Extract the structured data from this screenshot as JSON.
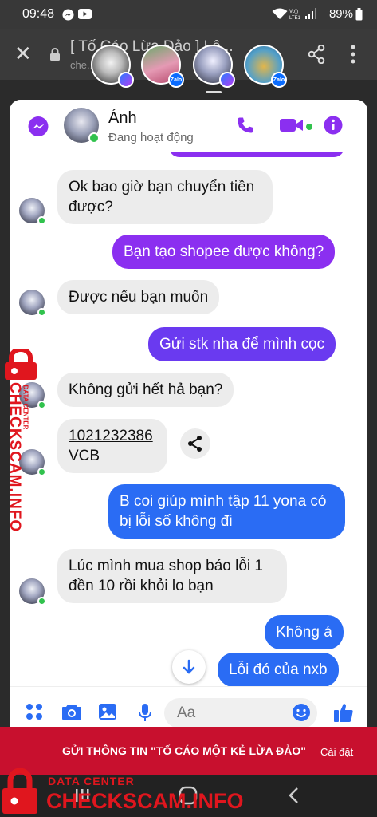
{
  "status_bar": {
    "time": "09:48",
    "battery": "89%"
  },
  "browser": {
    "title": "[ Tố Cáo Lừa Đảo ] Lê...",
    "url": "che...in"
  },
  "chat_heads": [
    {
      "badge": "messenger"
    },
    {
      "badge": "zalo",
      "badge_label": "Zalo"
    },
    {
      "badge": "messenger"
    },
    {
      "badge": "zalo",
      "badge_label": "Zalo"
    }
  ],
  "header": {
    "name": "Ánh",
    "status": "Đang hoạt động"
  },
  "messages": [
    {
      "from": "them",
      "text": "Ok bao giờ bạn chuyển tiền được?"
    },
    {
      "from": "me",
      "text": "Bạn tạo shopee được không?"
    },
    {
      "from": "them",
      "text": "Được nếu bạn muốn"
    },
    {
      "from": "me",
      "text": "Gửi stk nha để mình cọc"
    },
    {
      "from": "them",
      "text": "Không gửi hết hả bạn?"
    },
    {
      "from": "them",
      "account": "1021232386",
      "bank": "VCB"
    },
    {
      "from": "me",
      "text": "B coi giúp mình tập 11 yona có bị lỗi số không đi"
    },
    {
      "from": "them",
      "text": "Lúc mình mua shop báo lỗi 1 đền 10 rồi khỏi lo bạn"
    },
    {
      "from": "me",
      "text": "Không á"
    },
    {
      "from": "me",
      "text": "Lỗi đó của nxb"
    }
  ],
  "composer": {
    "placeholder": "Aa"
  },
  "banner": {
    "text": "GỬI THÔNG TIN \"TỐ CÁO MỘT KẺ LỪA ĐẢO\"",
    "settings": "Cài đặt"
  },
  "watermark": {
    "top_line": "DATA CENTER",
    "brand": "CHECKSCAM.INFO"
  },
  "colors": {
    "messenger_purple": "#8b2ff0",
    "messenger_blue": "#2a6cf4",
    "banner_red": "#c8102e",
    "online_green": "#31c24d"
  }
}
